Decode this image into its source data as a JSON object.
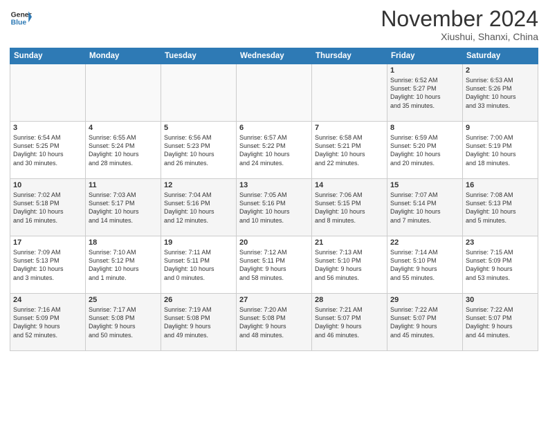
{
  "header": {
    "logo_line1": "General",
    "logo_line2": "Blue",
    "month": "November 2024",
    "location": "Xiushui, Shanxi, China"
  },
  "weekdays": [
    "Sunday",
    "Monday",
    "Tuesday",
    "Wednesday",
    "Thursday",
    "Friday",
    "Saturday"
  ],
  "weeks": [
    [
      {
        "day": "",
        "info": ""
      },
      {
        "day": "",
        "info": ""
      },
      {
        "day": "",
        "info": ""
      },
      {
        "day": "",
        "info": ""
      },
      {
        "day": "",
        "info": ""
      },
      {
        "day": "1",
        "info": "Sunrise: 6:52 AM\nSunset: 5:27 PM\nDaylight: 10 hours\nand 35 minutes."
      },
      {
        "day": "2",
        "info": "Sunrise: 6:53 AM\nSunset: 5:26 PM\nDaylight: 10 hours\nand 33 minutes."
      }
    ],
    [
      {
        "day": "3",
        "info": "Sunrise: 6:54 AM\nSunset: 5:25 PM\nDaylight: 10 hours\nand 30 minutes."
      },
      {
        "day": "4",
        "info": "Sunrise: 6:55 AM\nSunset: 5:24 PM\nDaylight: 10 hours\nand 28 minutes."
      },
      {
        "day": "5",
        "info": "Sunrise: 6:56 AM\nSunset: 5:23 PM\nDaylight: 10 hours\nand 26 minutes."
      },
      {
        "day": "6",
        "info": "Sunrise: 6:57 AM\nSunset: 5:22 PM\nDaylight: 10 hours\nand 24 minutes."
      },
      {
        "day": "7",
        "info": "Sunrise: 6:58 AM\nSunset: 5:21 PM\nDaylight: 10 hours\nand 22 minutes."
      },
      {
        "day": "8",
        "info": "Sunrise: 6:59 AM\nSunset: 5:20 PM\nDaylight: 10 hours\nand 20 minutes."
      },
      {
        "day": "9",
        "info": "Sunrise: 7:00 AM\nSunset: 5:19 PM\nDaylight: 10 hours\nand 18 minutes."
      }
    ],
    [
      {
        "day": "10",
        "info": "Sunrise: 7:02 AM\nSunset: 5:18 PM\nDaylight: 10 hours\nand 16 minutes."
      },
      {
        "day": "11",
        "info": "Sunrise: 7:03 AM\nSunset: 5:17 PM\nDaylight: 10 hours\nand 14 minutes."
      },
      {
        "day": "12",
        "info": "Sunrise: 7:04 AM\nSunset: 5:16 PM\nDaylight: 10 hours\nand 12 minutes."
      },
      {
        "day": "13",
        "info": "Sunrise: 7:05 AM\nSunset: 5:16 PM\nDaylight: 10 hours\nand 10 minutes."
      },
      {
        "day": "14",
        "info": "Sunrise: 7:06 AM\nSunset: 5:15 PM\nDaylight: 10 hours\nand 8 minutes."
      },
      {
        "day": "15",
        "info": "Sunrise: 7:07 AM\nSunset: 5:14 PM\nDaylight: 10 hours\nand 7 minutes."
      },
      {
        "day": "16",
        "info": "Sunrise: 7:08 AM\nSunset: 5:13 PM\nDaylight: 10 hours\nand 5 minutes."
      }
    ],
    [
      {
        "day": "17",
        "info": "Sunrise: 7:09 AM\nSunset: 5:13 PM\nDaylight: 10 hours\nand 3 minutes."
      },
      {
        "day": "18",
        "info": "Sunrise: 7:10 AM\nSunset: 5:12 PM\nDaylight: 10 hours\nand 1 minute."
      },
      {
        "day": "19",
        "info": "Sunrise: 7:11 AM\nSunset: 5:11 PM\nDaylight: 10 hours\nand 0 minutes."
      },
      {
        "day": "20",
        "info": "Sunrise: 7:12 AM\nSunset: 5:11 PM\nDaylight: 9 hours\nand 58 minutes."
      },
      {
        "day": "21",
        "info": "Sunrise: 7:13 AM\nSunset: 5:10 PM\nDaylight: 9 hours\nand 56 minutes."
      },
      {
        "day": "22",
        "info": "Sunrise: 7:14 AM\nSunset: 5:10 PM\nDaylight: 9 hours\nand 55 minutes."
      },
      {
        "day": "23",
        "info": "Sunrise: 7:15 AM\nSunset: 5:09 PM\nDaylight: 9 hours\nand 53 minutes."
      }
    ],
    [
      {
        "day": "24",
        "info": "Sunrise: 7:16 AM\nSunset: 5:09 PM\nDaylight: 9 hours\nand 52 minutes."
      },
      {
        "day": "25",
        "info": "Sunrise: 7:17 AM\nSunset: 5:08 PM\nDaylight: 9 hours\nand 50 minutes."
      },
      {
        "day": "26",
        "info": "Sunrise: 7:19 AM\nSunset: 5:08 PM\nDaylight: 9 hours\nand 49 minutes."
      },
      {
        "day": "27",
        "info": "Sunrise: 7:20 AM\nSunset: 5:08 PM\nDaylight: 9 hours\nand 48 minutes."
      },
      {
        "day": "28",
        "info": "Sunrise: 7:21 AM\nSunset: 5:07 PM\nDaylight: 9 hours\nand 46 minutes."
      },
      {
        "day": "29",
        "info": "Sunrise: 7:22 AM\nSunset: 5:07 PM\nDaylight: 9 hours\nand 45 minutes."
      },
      {
        "day": "30",
        "info": "Sunrise: 7:22 AM\nSunset: 5:07 PM\nDaylight: 9 hours\nand 44 minutes."
      }
    ]
  ]
}
